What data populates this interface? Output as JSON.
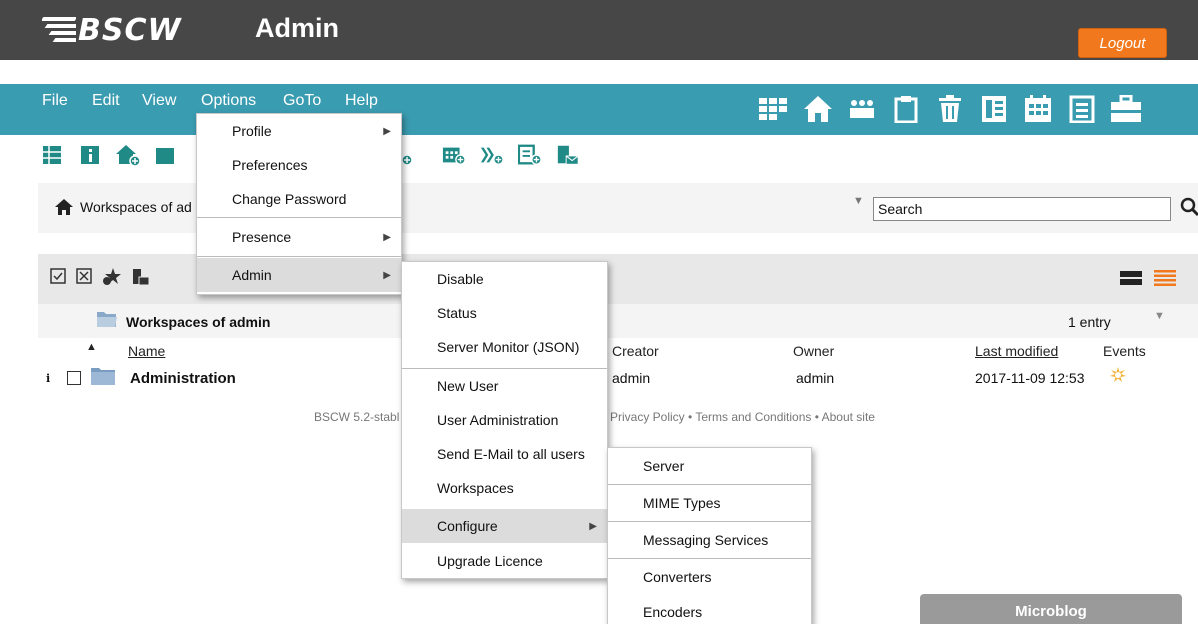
{
  "app": {
    "brand": "BSCW",
    "title": "Admin",
    "logout_label": "Logout"
  },
  "menubar": {
    "items": [
      "File",
      "Edit",
      "View",
      "Options",
      "GoTo",
      "Help"
    ]
  },
  "breadcrumb": {
    "text": "Workspaces of ad"
  },
  "search": {
    "value": "Search"
  },
  "folder": {
    "title": "Workspaces of admin",
    "count": "1 entry"
  },
  "columns": {
    "name": "Name",
    "creator": "Creator",
    "owner": "Owner",
    "modified": "Last modified",
    "events": "Events"
  },
  "rows": [
    {
      "name": "Administration",
      "creator": "admin",
      "owner": "admin",
      "modified": "2017-11-09 12:53"
    }
  ],
  "footer": {
    "left": "BSCW 5.2-stabl",
    "right": "Privacy Policy  •  Terms and Conditions  •  About site"
  },
  "options_menu": {
    "items": [
      "Profile",
      "Preferences",
      "Change Password",
      "Presence",
      "Admin"
    ]
  },
  "admin_menu": {
    "items": [
      "Disable",
      "Status",
      "Server Monitor (JSON)",
      "New User",
      "User Administration",
      "Send E-Mail to all users",
      "Workspaces",
      "Configure",
      "Upgrade Licence"
    ]
  },
  "configure_menu": {
    "items": [
      "Server",
      "MIME Types",
      "Messaging Services",
      "Converters",
      "Encoders"
    ]
  },
  "microblog": {
    "label": "Microblog"
  },
  "colors": {
    "header": "#474747",
    "menubar": "#3a9cb1",
    "accent": "#f2781d",
    "icon": "#1f8a86"
  }
}
